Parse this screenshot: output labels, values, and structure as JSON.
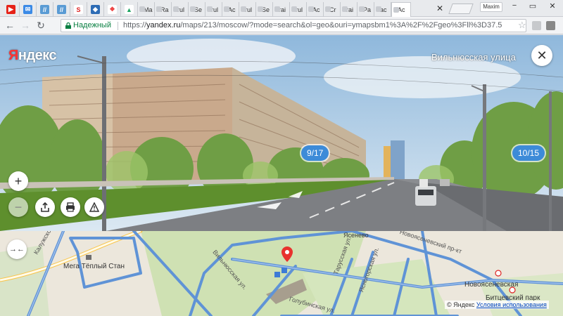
{
  "browser": {
    "user": "Maxim",
    "url_secure_label": "Надежный",
    "url_scheme": "https://",
    "url_host": "yandex.ru",
    "url_path": "/maps/213/moscow/?mode=search&ol=geo&ouri=ymapsbm1%3A%2F%2Fgeo%3Fll%3D37.5",
    "tabs": [
      "Ma",
      "Ra",
      "rul",
      "Se",
      "rul",
      "Ac",
      "rul",
      "Se",
      "rai",
      "rul",
      "Ac",
      "Cr",
      "rai",
      "Pa",
      "ac",
      "Ac"
    ]
  },
  "panorama": {
    "logo_main": "Я",
    "logo_rest": "ндекс",
    "street_name": "Вильнюсская улица",
    "direction_left": "9/17",
    "direction_right": "10/15",
    "zoom_in": "+",
    "zoom_out": "−"
  },
  "map": {
    "labels": {
      "mega": "Мега Тёплый Стан",
      "yasenevo": "Ясенево",
      "novoyasenevskaya": "Новоясеневская",
      "bitsevsky_park": "Битцевский парк",
      "kaluzhskoe": "Калужское",
      "novoyasenevsky_prospekt": "Новоясеневский пр-кт",
      "tarusskaya": "Тарусская ул.",
      "vilnyusskaya": "Вильнюсская ул.",
      "yasnogorskaya": "Ясногорская ул.",
      "golubinskaya": "Голубинская ул."
    },
    "copyright": "© Яндекс",
    "terms": "Условия использования"
  }
}
